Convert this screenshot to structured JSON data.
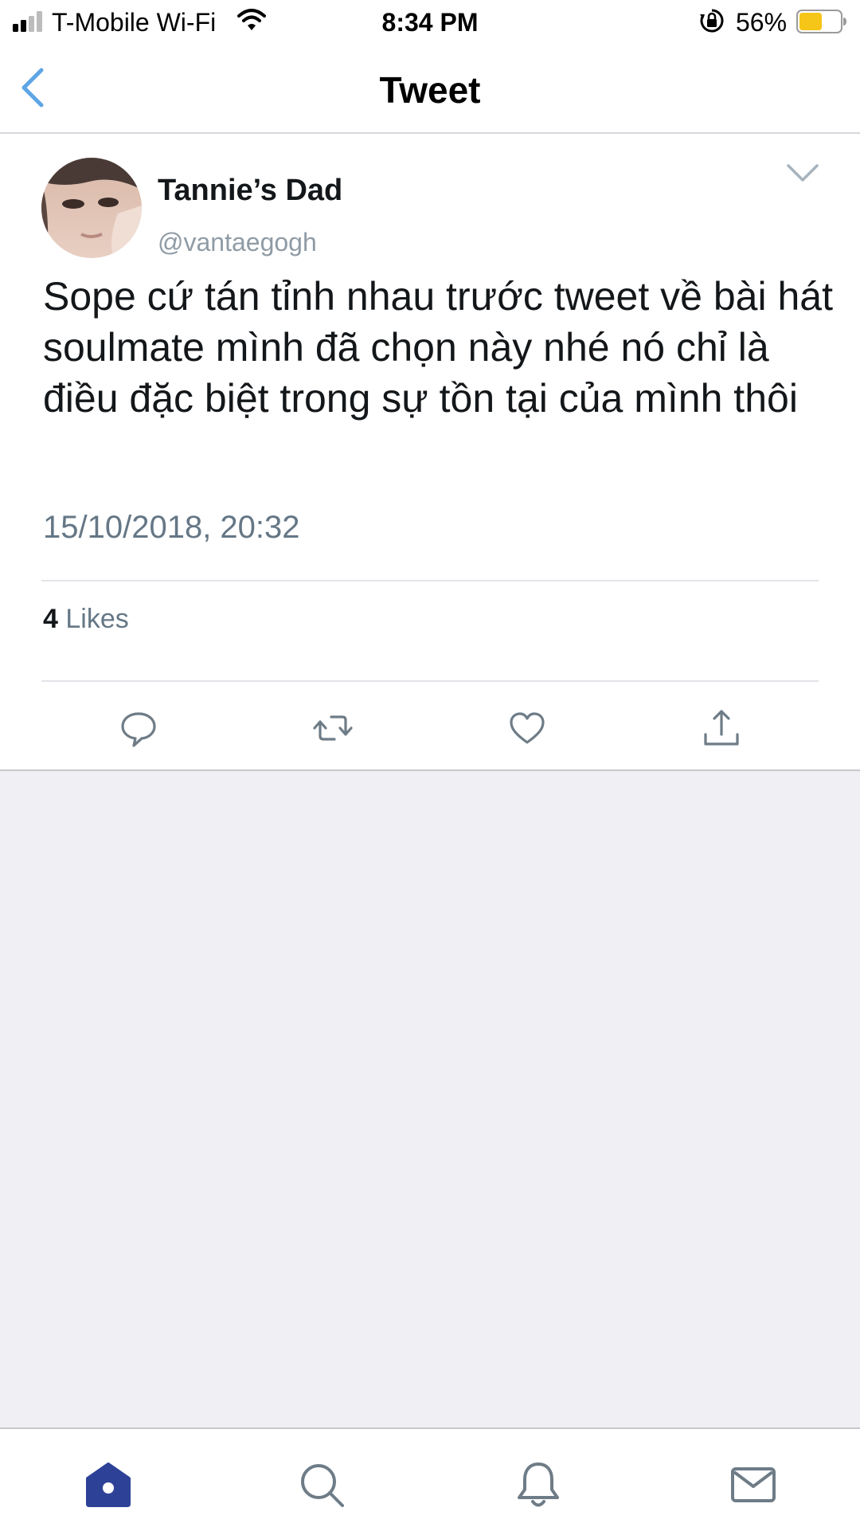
{
  "status_bar": {
    "carrier": "T-Mobile Wi-Fi",
    "time": "8:34 PM",
    "battery_percent": "56%",
    "battery_level": 0.56,
    "icons": [
      "signal-icon",
      "wifi-icon",
      "rotation-lock-icon",
      "battery-icon"
    ]
  },
  "nav": {
    "title": "Tweet",
    "back_icon": "chevron-left-icon"
  },
  "tweet": {
    "display_name": "Tannie’s Dad",
    "handle": "@vantaegogh",
    "text": "Sope cứ tán tỉnh nhau trước tweet về bài hát soulmate mình đã chọn này nhé nó chỉ là điều đặc biệt trong sự tồn tại của mình thôi",
    "timestamp": "15/10/2018, 20:32",
    "likes_count": "4",
    "likes_label": "Likes",
    "actions": [
      "reply-icon",
      "retweet-icon",
      "like-icon",
      "share-icon"
    ]
  },
  "tab_bar": {
    "tabs": [
      "home-icon",
      "search-icon",
      "notifications-icon",
      "messages-icon"
    ],
    "active": "home-icon"
  },
  "colors": {
    "accent_blue": "#1da1f2",
    "back_blue": "#5fa5e6",
    "active_tab": "#2d4296",
    "icon_gray": "#6e7c87",
    "background_gray": "#efeff4",
    "battery_yellow": "#f5c518"
  }
}
